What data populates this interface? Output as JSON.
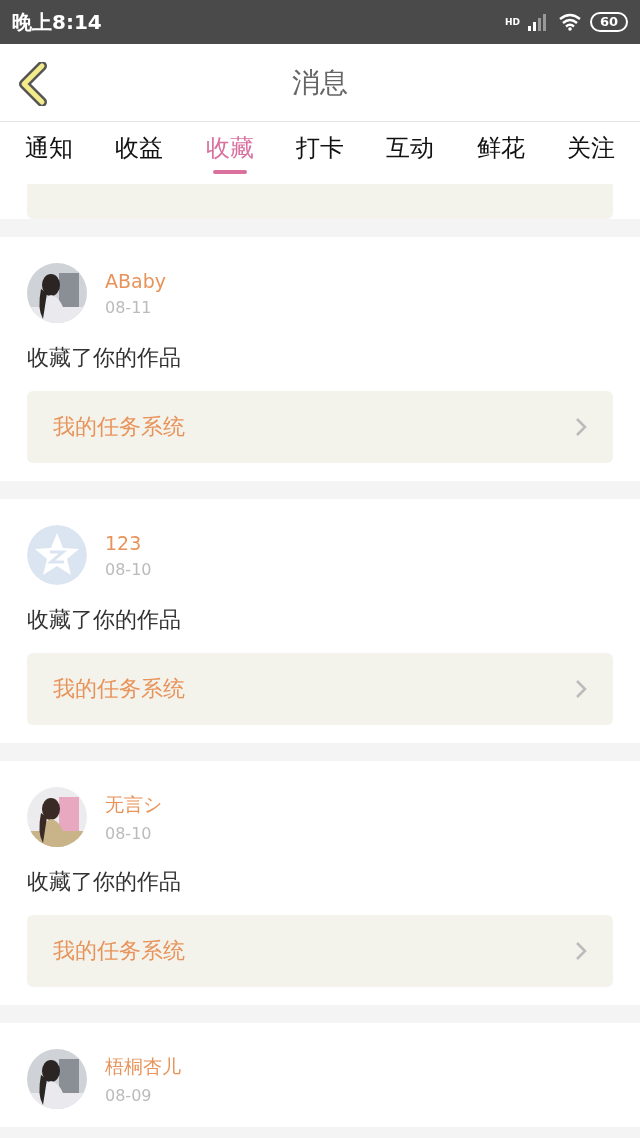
{
  "status_bar": {
    "time": "晚上8:14",
    "network": "HD",
    "battery": "60"
  },
  "header": {
    "title": "消息"
  },
  "tabs": [
    {
      "label": "通知",
      "selected": false
    },
    {
      "label": "收益",
      "selected": false
    },
    {
      "label": "收藏",
      "selected": true
    },
    {
      "label": "打卡",
      "selected": false
    },
    {
      "label": "互动",
      "selected": false
    },
    {
      "label": "鲜花",
      "selected": false
    },
    {
      "label": "关注",
      "selected": false
    }
  ],
  "messages": [
    {
      "name": "ABaby",
      "date": "08-11",
      "text": "收藏了你的作品",
      "link": "我的任务系统",
      "kind": "picture"
    },
    {
      "name": "123",
      "date": "08-10",
      "text": "收藏了你的作品",
      "link": "我的任务系统",
      "kind": "star"
    },
    {
      "name": "无言シ",
      "date": "08-10",
      "text": "收藏了你的作品",
      "link": "我的任务系统",
      "kind": "picture"
    },
    {
      "name": "梧桐杏儿",
      "date": "08-09",
      "kind": "picture"
    }
  ]
}
